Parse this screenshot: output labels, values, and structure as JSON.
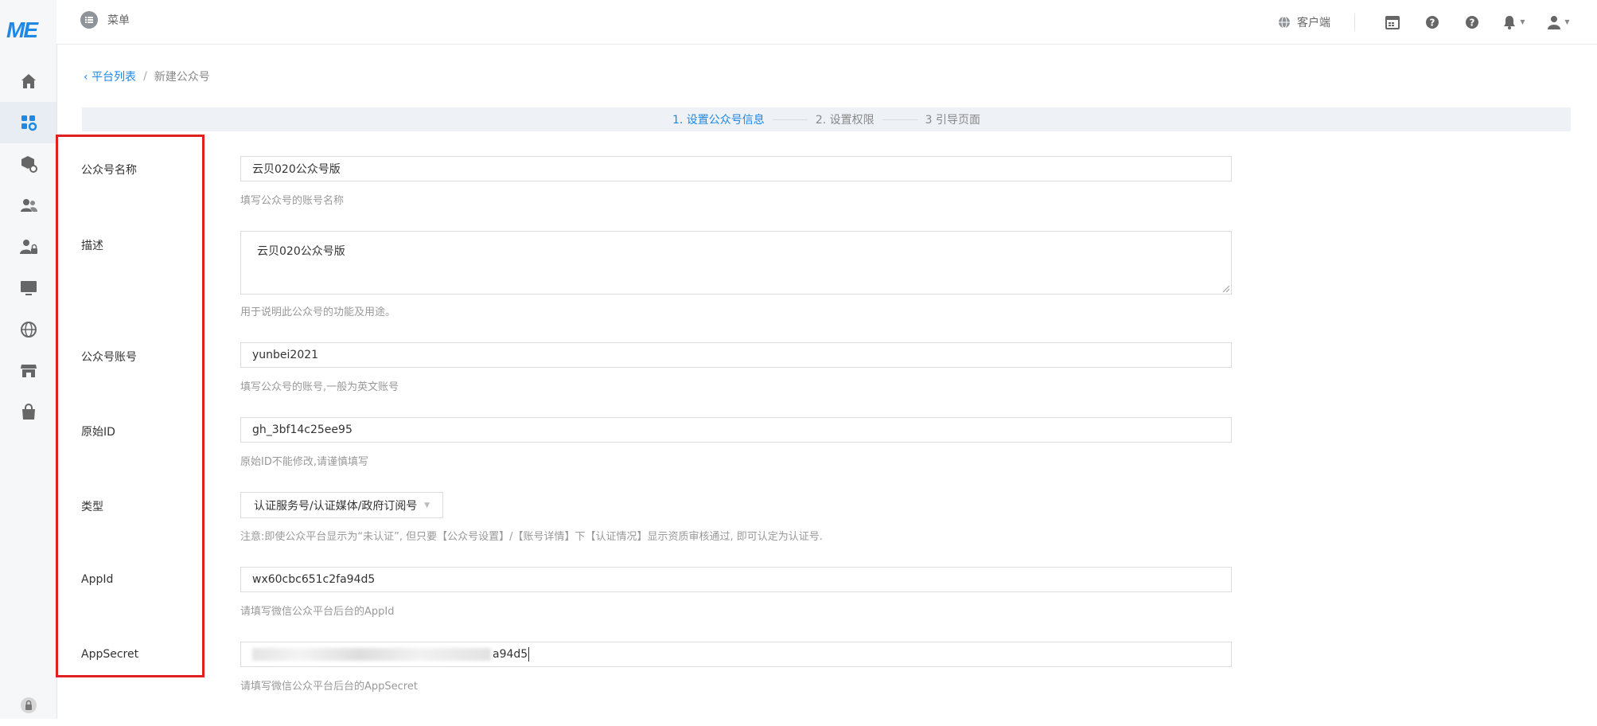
{
  "logo": "ME",
  "topbar": {
    "menu_label": "菜单",
    "client_label": "客户端"
  },
  "breadcrumb": {
    "back": "平台列表",
    "separator": "/",
    "current": "新建公众号"
  },
  "steps": [
    "1. 设置公众号信息",
    "2. 设置权限",
    "3 引导页面"
  ],
  "form": {
    "name": {
      "label": "公众号名称",
      "value": "云贝020公众号版",
      "help": "填写公众号的账号名称"
    },
    "description": {
      "label": "描述",
      "value": "云贝020公众号版",
      "help": "用于说明此公众号的功能及用途。"
    },
    "account": {
      "label": "公众号账号",
      "value": "yunbei2021",
      "help": "填写公众号的账号,一般为英文账号"
    },
    "original_id": {
      "label": "原始ID",
      "value": "gh_3bf14c25ee95",
      "help": "原始ID不能修改,请谨慎填写"
    },
    "type": {
      "label": "类型",
      "value": "认证服务号/认证媒体/政府订阅号",
      "help": "注意:即使公众平台显示为“未认证”, 但只要【公众号设置】/【账号详情】下【认证情况】显示资质审核通过, 即可认定为认证号."
    },
    "appid": {
      "label": "AppId",
      "value": "wx60cbc651c2fa94d5",
      "help": "请填写微信公众平台后台的AppId"
    },
    "appsecret": {
      "label": "AppSecret",
      "value_suffix": "a94d5",
      "help": "请填写微信公众平台后台的AppSecret"
    }
  },
  "colors": {
    "accent": "#1e88e5",
    "highlight": "#e02020"
  }
}
